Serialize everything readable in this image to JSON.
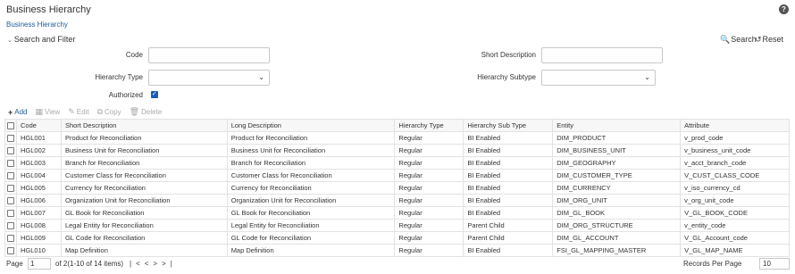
{
  "header": {
    "title": "Business Hierarchy",
    "help_icon": "?",
    "breadcrumb": "Business Hierarchy"
  },
  "search_panel": {
    "toggle_label": "Search and Filter",
    "search_label": "Search",
    "reset_label": "Reset",
    "fields": {
      "code": {
        "label": "Code",
        "value": ""
      },
      "short_description": {
        "label": "Short Description",
        "value": ""
      },
      "hierarchy_type": {
        "label": "Hierarchy Type",
        "value": ""
      },
      "hierarchy_subtype": {
        "label": "Hierarchy Subtype",
        "value": ""
      },
      "authorized": {
        "label": "Authorized",
        "checked": true
      }
    }
  },
  "toolbar": {
    "add": "Add",
    "view": "View",
    "edit": "Edit",
    "copy": "Copy",
    "delete": "Delete"
  },
  "table": {
    "columns": [
      "Code",
      "Short Description",
      "Long Description",
      "Hierarchy Type",
      "Hierarchy Sub Type",
      "Entity",
      "Attribute"
    ],
    "rows": [
      [
        "HGL001",
        "Product for Reconciliation",
        "Product for Reconciliation",
        "Regular",
        "BI Enabled",
        "DIM_PRODUCT",
        "v_prod_code"
      ],
      [
        "HGL002",
        "Business Unit for Reconciliation",
        "Business Unit for Reconciliation",
        "Regular",
        "BI Enabled",
        "DIM_BUSINESS_UNIT",
        "v_business_unit_code"
      ],
      [
        "HGL003",
        "Branch for Reconciliation",
        "Branch for Reconciliation",
        "Regular",
        "BI Enabled",
        "DIM_GEOGRAPHY",
        "v_acct_branch_code"
      ],
      [
        "HGL004",
        "Customer Class for Reconciliation",
        "Customer Class for Reconciliation",
        "Regular",
        "BI Enabled",
        "DIM_CUSTOMER_TYPE",
        "V_CUST_CLASS_CODE"
      ],
      [
        "HGL005",
        "Currency for Reconciliation",
        "Currency for Reconciliation",
        "Regular",
        "BI Enabled",
        "DIM_CURRENCY",
        "v_iso_currency_cd"
      ],
      [
        "HGL006",
        "Organization Unit for Reconciliation",
        "Organization Unit for Reconciliation",
        "Regular",
        "BI Enabled",
        "DIM_ORG_UNIT",
        "v_org_unit_code"
      ],
      [
        "HGL007",
        "GL Book for Reconciliation",
        "GL Book for Reconciliation",
        "Regular",
        "BI Enabled",
        "DIM_GL_BOOK",
        "V_GL_BOOK_CODE"
      ],
      [
        "HGL008",
        "Legal Entity for Reconciliation",
        "Legal Entity for Reconciliation",
        "Regular",
        "Parent Child",
        "DIM_ORG_STRUCTURE",
        "v_entity_code"
      ],
      [
        "HGL009",
        "GL Code for Reconciliation",
        "GL Code for Reconciliation",
        "Regular",
        "Parent Child",
        "DIM_GL_ACCOUNT",
        "V_GL_Account_code"
      ],
      [
        "HGL010",
        "Map Definition",
        "Map Definition",
        "Regular",
        "BI Enabled",
        "FSI_GL_MAPPING_MASTER",
        "V_GL_MAP_NAME"
      ]
    ]
  },
  "pagination": {
    "page_label": "Page",
    "page_value": "1",
    "of_text": "of 2(1-10 of 14 items)",
    "records_label": "Records Per Page",
    "records_value": "10"
  }
}
